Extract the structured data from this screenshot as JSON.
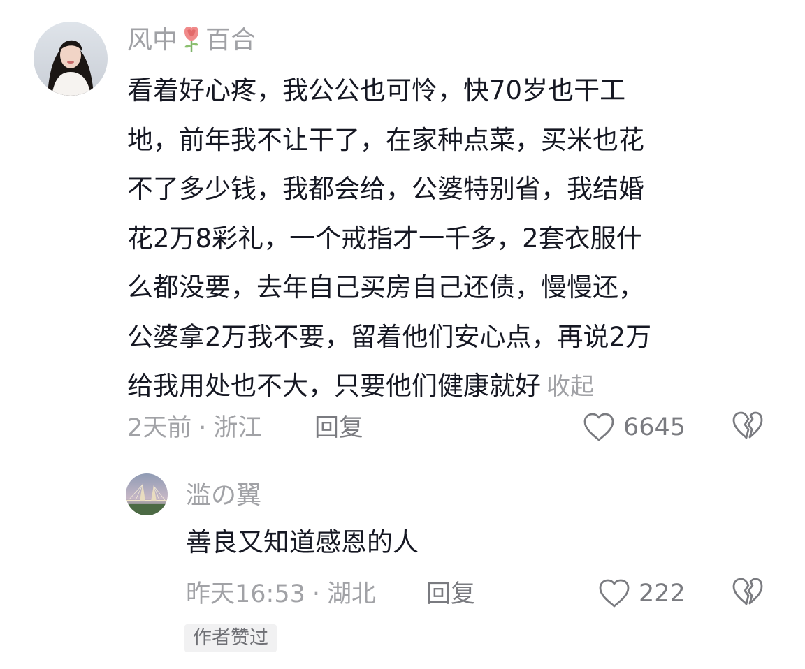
{
  "main_comment": {
    "username_parts": [
      "风中",
      "百合"
    ],
    "username_emoji_icon": "rose-icon",
    "lines": [
      "看着好心疼，我公公也可怜，快70岁也干工",
      "地，前年我不让干了，在家种点菜，买米也花",
      "不了多少钱，我都会给，公婆特别省，我结婚",
      "花2万8彩礼，一个戒指才一千多，2套衣服什",
      "么都没要，去年自己买房自己还债，慢慢还，",
      "公婆拿2万我不要，留着他们安心点，再说2万",
      "给我用处也不大，只要他们健康就好"
    ],
    "collapse_label": "收起",
    "time": "2天前",
    "separator": "·",
    "location": "浙江",
    "reply_label": "回复",
    "like_count": "6645"
  },
  "reply_comment": {
    "username": "滥の翼",
    "text": "善良又知道感恩的人",
    "time": "昨天16:53",
    "separator": "·",
    "location": "湖北",
    "reply_label": "回复",
    "like_count": "222",
    "author_liked_badge": "作者赞过"
  },
  "colors": {
    "text_primary": "#161823",
    "text_secondary": "#a1a2a6",
    "action_text": "#7a7b80",
    "badge_bg": "#f1f1f2",
    "background": "#ffffff"
  }
}
